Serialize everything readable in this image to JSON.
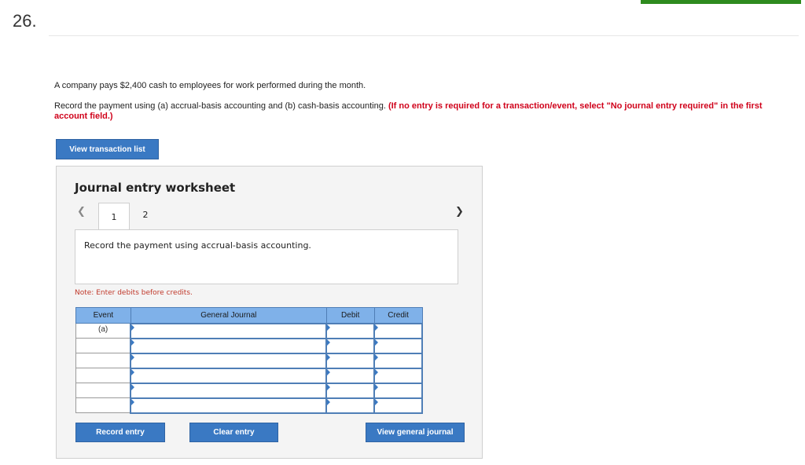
{
  "question": {
    "number": "26."
  },
  "prompt": "A company pays $2,400 cash to employees for work performed during the month.",
  "instruction": {
    "text": "Record the payment using (a) accrual-basis accounting and (b) cash-basis accounting. ",
    "emphasis": "(If no entry is required for a transaction/event, select \"No journal entry required\" in the first account field.)"
  },
  "buttons": {
    "view_transaction_list": "View transaction list",
    "record_entry": "Record entry",
    "clear_entry": "Clear entry",
    "view_general_journal": "View general journal"
  },
  "worksheet": {
    "title": "Journal entry worksheet",
    "tabs": [
      "1",
      "2"
    ],
    "active_tab": "1",
    "description": "Record the payment using accrual-basis accounting.",
    "note": "Note: Enter debits before credits."
  },
  "table": {
    "headers": {
      "event": "Event",
      "general_journal": "General Journal",
      "debit": "Debit",
      "credit": "Credit"
    },
    "rows": [
      {
        "event": "(a)",
        "account": "",
        "debit": "",
        "credit": ""
      },
      {
        "event": "",
        "account": "",
        "debit": "",
        "credit": ""
      },
      {
        "event": "",
        "account": "",
        "debit": "",
        "credit": ""
      },
      {
        "event": "",
        "account": "",
        "debit": "",
        "credit": ""
      },
      {
        "event": "",
        "account": "",
        "debit": "",
        "credit": ""
      },
      {
        "event": "",
        "account": "",
        "debit": "",
        "credit": ""
      }
    ]
  },
  "icons": {
    "prev": "chevron-left-icon",
    "next": "chevron-right-icon"
  },
  "colors": {
    "button": "#3a79c3",
    "table_header": "#7fb1e9",
    "emphasis_red": "#d0021b",
    "progress_green": "#2e8b1e"
  }
}
